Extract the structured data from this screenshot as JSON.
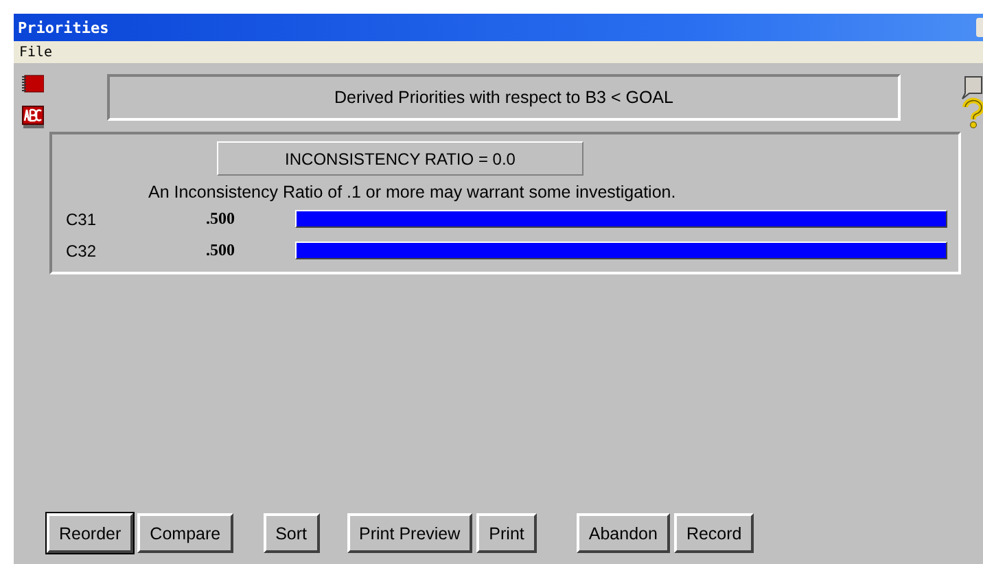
{
  "window": {
    "title": "Priorities"
  },
  "menu": [
    "File"
  ],
  "heading": "Derived Priorities with respect to B3 < GOAL",
  "inconsistency": {
    "ratio": "INCONSISTENCY RATIO = 0.0",
    "note": "An Inconsistency Ratio of .1 or more may warrant some investigation."
  },
  "priorities": [
    {
      "name": "C31",
      "value": ".500",
      "level": 1
    },
    {
      "name": "C32",
      "value": ".500",
      "level": 1
    }
  ],
  "button_groups": [
    [
      {
        "label": "Reorder",
        "focused": true
      },
      {
        "label": "Compare",
        "focused": false
      }
    ],
    [
      {
        "label": "Sort",
        "focused": false
      }
    ],
    [
      {
        "label": "Print Preview",
        "focused": false
      },
      {
        "label": "Print",
        "focused": false
      }
    ],
    [
      {
        "label": "Abandon",
        "focused": false
      },
      {
        "label": "Record",
        "focused": false
      }
    ]
  ]
}
